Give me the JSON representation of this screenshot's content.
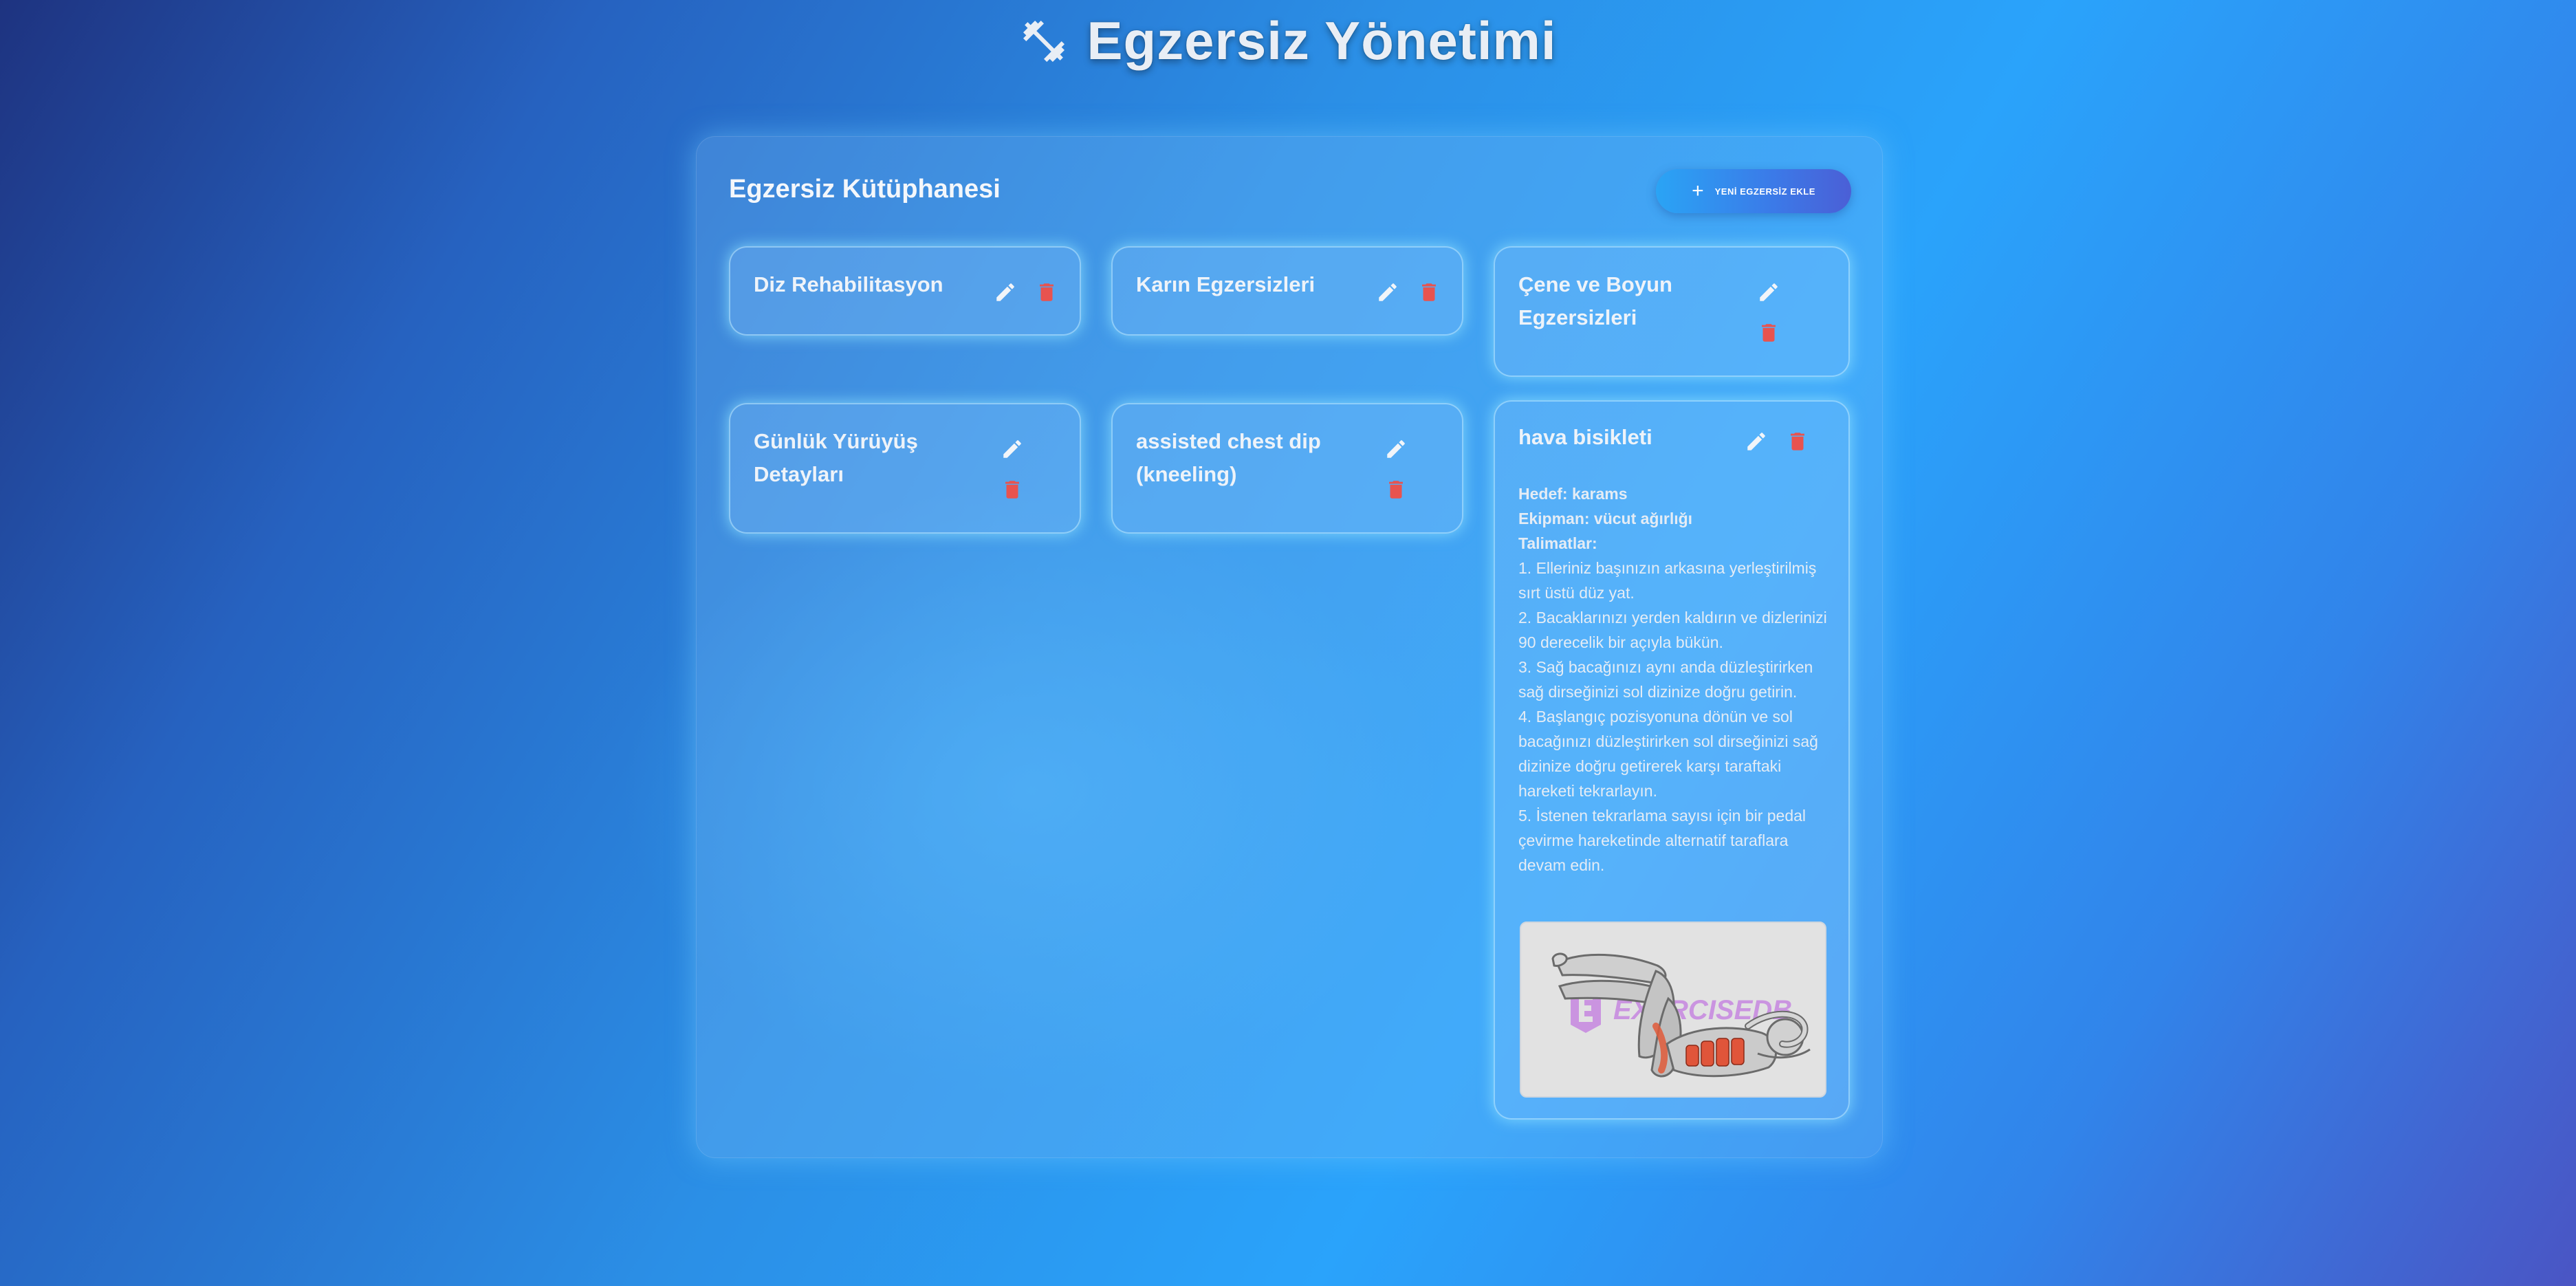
{
  "header": {
    "title": "Egzersiz Yönetimi",
    "icon": "dumbbell-icon"
  },
  "library": {
    "title": "Egzersiz Kütüphanesi",
    "add_button_label": "YENİ EGZERSİZ EKLE"
  },
  "exercises": [
    {
      "name": "Diz Rehabilitasyon"
    },
    {
      "name": "Karın Egzersizleri"
    },
    {
      "name": "Çene ve Boyun Egzersizleri"
    },
    {
      "name": "Günlük Yürüyüş Detayları"
    },
    {
      "name": "assisted chest dip (kneeling)"
    },
    {
      "name": "hava bisikleti",
      "target_label": "Hedef: karams",
      "equipment_label": "Ekipman: vücut ağırlığı",
      "instructions_label": "Talimatlar:",
      "instructions": [
        "1. Elleriniz başınızın arkasına yerleştirilmiş sırt üstü düz yat.",
        "2. Bacaklarınızı yerden kaldırın ve dizlerinizi 90 derecelik bir açıyla bükün.",
        "3. Sağ bacağınızı aynı anda düzleştirirken sağ dirseğinizi sol dizinize doğru getirin.",
        "4. Başlangıç pozisyonuna dönün ve sol bacağınızı düzleştirirken sol dirseğinizi sağ dizinize doğru getirerek karşı taraftaki hareketi tekrarlayın.",
        "5. İstenen tekrarlama sayısı için bir pedal çevirme hareketinde alternatif taraflara devam edin."
      ],
      "image_watermark": "EXERCISEDB"
    }
  ],
  "colors": {
    "delete_icon": "#e8534f",
    "edit_icon": "#f2f5f9",
    "watermark": "#c27be0"
  }
}
